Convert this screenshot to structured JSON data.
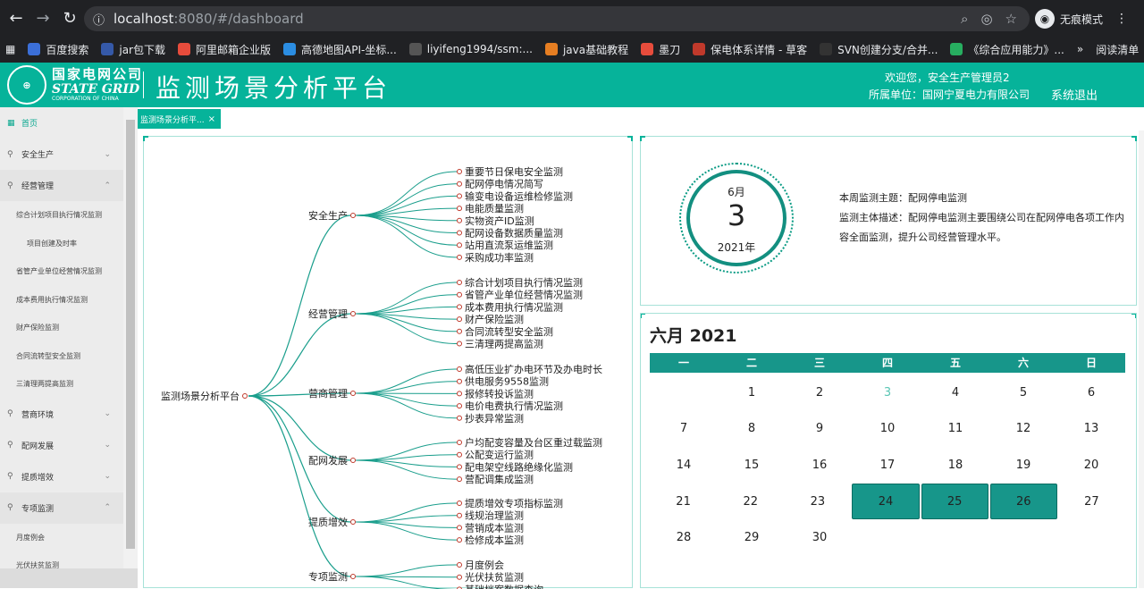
{
  "browser": {
    "url_host": "localhost",
    "url_rest": ":8080/#/dashboard",
    "incognito_label": "无痕模式",
    "bookmarks": [
      {
        "label": "百度搜索",
        "color": "#3b6fd8"
      },
      {
        "label": "jar包下载",
        "color": "#3559a8"
      },
      {
        "label": "阿里邮箱企业版",
        "color": "#e74c3c"
      },
      {
        "label": "高德地图API-坐标...",
        "color": "#2b8de2"
      },
      {
        "label": "liyifeng1994/ssm:...",
        "color": "#555555"
      },
      {
        "label": "java基础教程",
        "color": "#e67e22"
      },
      {
        "label": "墨刀",
        "color": "#e74c3c"
      },
      {
        "label": "保电体系详情 - 草客",
        "color": "#c0392b"
      },
      {
        "label": "SVN创建分支/合并...",
        "color": "#333333"
      },
      {
        "label": "《综合应用能力》...",
        "color": "#27ae60"
      }
    ],
    "more_label": "»",
    "reading_list": "阅读清单"
  },
  "header": {
    "logo_cn": "国家电网公司",
    "logo_en": "STATE GRID",
    "logo_en2": "CORPORATION OF CHINA",
    "title": "监测场景分析平台",
    "welcome": "欢迎您，安全生产管理员2",
    "unit": "所属单位：国网宁夏电力有限公司",
    "logout": "系统退出"
  },
  "sidebar": {
    "items": [
      {
        "label": "首页",
        "icon": "grid-icon",
        "active": true
      },
      {
        "label": "安全生产",
        "icon": "location-icon",
        "chevron": "down"
      },
      {
        "label": "经营管理",
        "icon": "location-icon",
        "chevron": "up",
        "expanded": true,
        "children": [
          {
            "label": "综合计划项目执行情况监测",
            "indent": false
          },
          {
            "label": "项目创建及时率",
            "indent": true
          },
          {
            "label": "省管产业单位经营情况监测",
            "indent": false
          },
          {
            "label": "成本费用执行情况监测",
            "indent": false
          },
          {
            "label": "财产保险监测",
            "indent": false
          },
          {
            "label": "合同流转型安全监测",
            "indent": false
          },
          {
            "label": "三清理两提高监测",
            "indent": false
          }
        ]
      },
      {
        "label": "营商环境",
        "icon": "location-icon",
        "chevron": "down"
      },
      {
        "label": "配网发展",
        "icon": "location-icon",
        "chevron": "down"
      },
      {
        "label": "提质增效",
        "icon": "location-icon",
        "chevron": "down"
      },
      {
        "label": "专项监测",
        "icon": "location-icon",
        "chevron": "up",
        "expanded": true,
        "children": [
          {
            "label": "月度例会",
            "indent": false
          },
          {
            "label": "光伏扶贫监测",
            "indent": false
          }
        ]
      }
    ]
  },
  "page_tab": {
    "label": "监测场景分析平...",
    "close": "×"
  },
  "mindmap": {
    "root": "监测场景分析平台",
    "branches": [
      {
        "label": "安全生产",
        "leaves": [
          "重要节日保电安全监测",
          "配网停电情况简写",
          "输变电设备运维检修监测",
          "电能质量监测",
          "实物资产ID监测",
          "配网设备数据质量监测",
          "站用直流泵运维监测",
          "采购成功率监测"
        ]
      },
      {
        "label": "经营管理",
        "leaves": [
          "综合计划项目执行情况监测",
          "省管产业单位经营情况监测",
          "成本费用执行情况监测",
          "财产保险监测",
          "合同流转型安全监测",
          "三清理两提高监测"
        ]
      },
      {
        "label": "营商管理",
        "leaves": [
          "高低压业扩办电环节及办电时长",
          "供电服务9558监测",
          "报修转投诉监测",
          "电价电费执行情况监测",
          "抄表异常监测"
        ]
      },
      {
        "label": "配网发展",
        "leaves": [
          "户均配变容量及台区重过载监测",
          "公配变运行监测",
          "配电架空线路绝缘化监测",
          "营配调集成监测"
        ]
      },
      {
        "label": "提质增效",
        "leaves": [
          "提质增效专项指标监测",
          "线规治理监测",
          "营销成本监测",
          "检修成本监测"
        ]
      },
      {
        "label": "专项监测",
        "leaves": [
          "月度例会",
          "光伏扶贫监测",
          "基础档案数据查询"
        ]
      }
    ]
  },
  "theme": {
    "month": "6月",
    "day": "3",
    "year": "2021年",
    "topic": "本周监测主题：配网停电监测",
    "description": "监测主体描述：配网停电监测主要围绕公司在配网停电各项工作内容全面监测，提升公司经营管理水平。"
  },
  "calendar": {
    "title": "六月 2021",
    "weekdays": [
      "一",
      "二",
      "三",
      "四",
      "五",
      "六",
      "日"
    ],
    "weeks": [
      [
        "",
        "1",
        "2",
        "3",
        "4",
        "5",
        "6"
      ],
      [
        "7",
        "8",
        "9",
        "10",
        "11",
        "12",
        "13"
      ],
      [
        "14",
        "15",
        "16",
        "17",
        "18",
        "19",
        "20"
      ],
      [
        "21",
        "22",
        "23",
        "24",
        "25",
        "26",
        "27"
      ],
      [
        "28",
        "29",
        "30",
        "",
        "",
        "",
        ""
      ]
    ],
    "today": "3",
    "selected": [
      "24",
      "25",
      "26"
    ],
    "accent": "#17968a"
  }
}
